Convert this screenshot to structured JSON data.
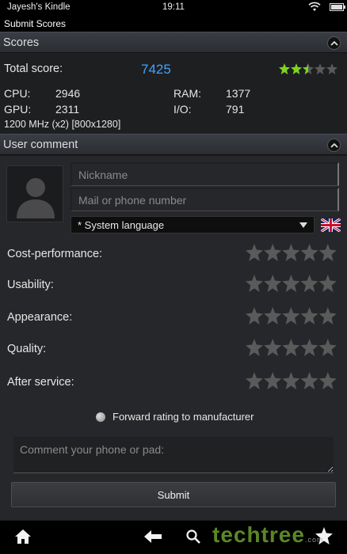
{
  "status_bar": {
    "device_name": "Jayesh's Kindle",
    "time": "19:11",
    "wifi_icon": "wifi-icon",
    "battery_icon": "battery-icon"
  },
  "title_bar": {
    "title": "Submit Scores"
  },
  "scores": {
    "header": "Scores",
    "total_label": "Total score:",
    "total_value": "7425",
    "star_rating": 2.5,
    "cpu_label": "CPU:",
    "cpu_value": "2946",
    "ram_label": "RAM:",
    "ram_value": "1377",
    "gpu_label": "GPU:",
    "gpu_value": "2311",
    "io_label": "I/O:",
    "io_value": "791",
    "device_spec": "1200 MHz (x2) [800x1280]"
  },
  "user_comment": {
    "header": "User comment",
    "nickname_placeholder": "Nickname",
    "contact_placeholder": "Mail or phone number",
    "language_selected": "* System language",
    "flag_icon": "uk-flag-icon",
    "ratings": [
      {
        "label": "Cost-performance:"
      },
      {
        "label": "Usability:"
      },
      {
        "label": "Appearance:"
      },
      {
        "label": "Quality:"
      },
      {
        "label": "After service:"
      }
    ],
    "forward_label": "Forward rating to manufacturer",
    "comment_placeholder": "Comment your phone or pad:",
    "submit_label": "Submit"
  },
  "nav_bar": {
    "home_icon": "home-icon",
    "back_icon": "back-arrow-icon",
    "search_icon": "search-icon",
    "favorite_icon": "star-icon"
  },
  "watermark": {
    "text": "techtree",
    "subtext": ".com"
  },
  "colors": {
    "accent_blue": "#3fa3ff",
    "star_green": "#7ed321",
    "star_empty": "#5a5a5a"
  }
}
